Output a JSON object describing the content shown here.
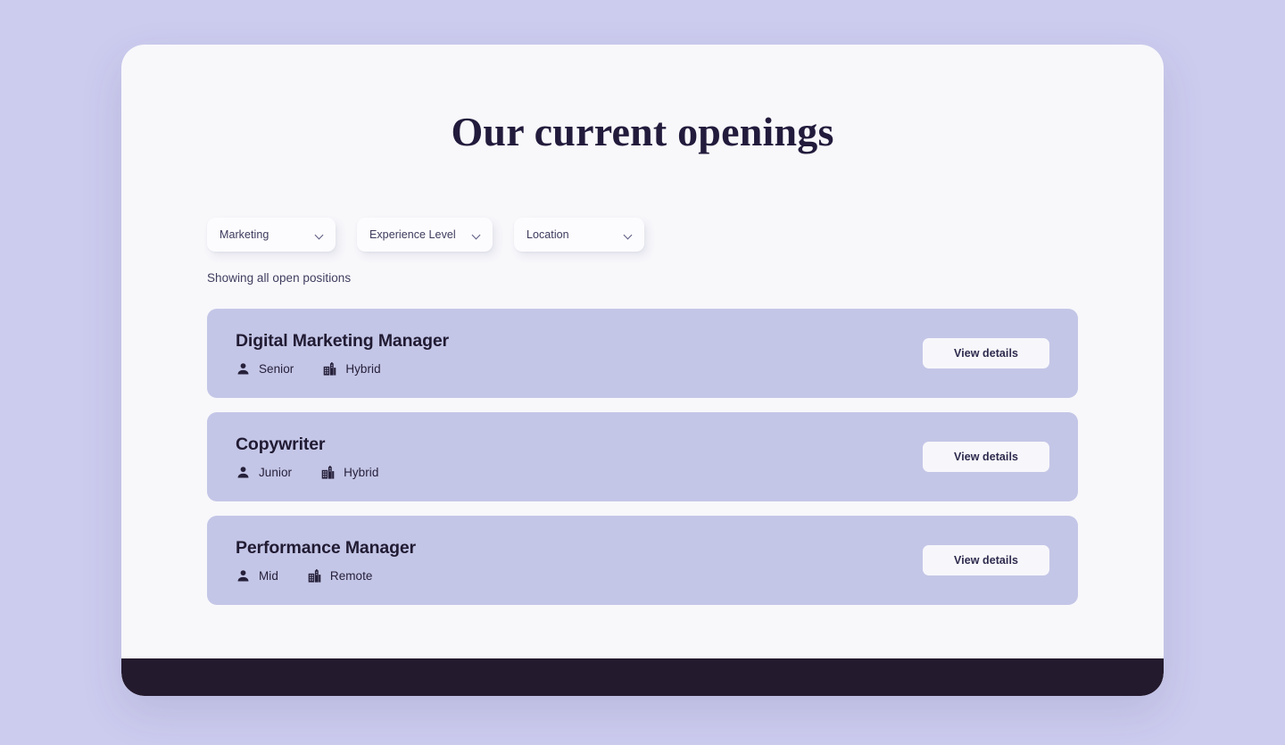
{
  "page": {
    "title": "Our current openings",
    "results_caption": "Showing all open positions"
  },
  "colors": {
    "page_background": "#ccccef",
    "panel_background": "#f8f8fb",
    "footer_bar": "#241a2e",
    "card_background": "#c4c6e7",
    "title_text": "#231b3c",
    "button_background": "#f7f7fb"
  },
  "filters": [
    {
      "name": "department",
      "label": "Marketing",
      "icon": "chevron-down-icon"
    },
    {
      "name": "experience",
      "label": "Experience Level",
      "icon": "chevron-down-icon"
    },
    {
      "name": "location",
      "label": "Location",
      "icon": "chevron-down-icon"
    }
  ],
  "jobs": [
    {
      "title": "Digital Marketing Manager",
      "level": "Senior",
      "level_icon": "person-icon",
      "work_mode": "Hybrid",
      "work_mode_icon": "building-icon",
      "action_label": "View details"
    },
    {
      "title": "Copywriter",
      "level": "Junior",
      "level_icon": "person-icon",
      "work_mode": "Hybrid",
      "work_mode_icon": "building-icon",
      "action_label": "View details"
    },
    {
      "title": "Performance Manager",
      "level": "Mid",
      "level_icon": "person-icon",
      "work_mode": "Remote",
      "work_mode_icon": "building-icon",
      "action_label": "View details"
    }
  ]
}
